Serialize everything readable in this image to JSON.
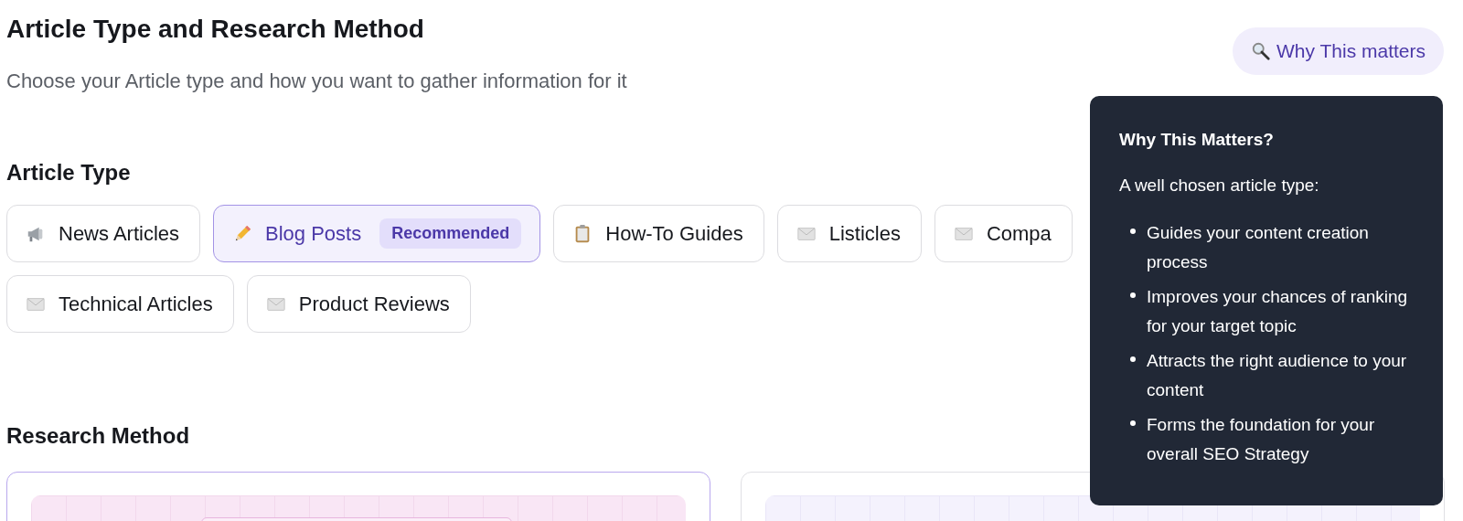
{
  "header": {
    "title": "Article Type and Research Method",
    "subtitle": "Choose your Article type and how you want to gather information for it",
    "help_button": {
      "label": "Why This matters"
    }
  },
  "article_type": {
    "heading": "Article Type",
    "options": [
      {
        "label": "News Articles",
        "kind": "megaphone",
        "selected": false
      },
      {
        "label": "Blog Posts",
        "kind": "pencil",
        "selected": true,
        "badge": "Recommended"
      },
      {
        "label": "How-To Guides",
        "kind": "clipboard",
        "selected": false
      },
      {
        "label": "Listicles",
        "kind": "envelope",
        "selected": false
      },
      {
        "label": "Compa",
        "kind": "envelope",
        "selected": false
      },
      {
        "label": "Technical Articles",
        "kind": "envelope",
        "selected": false
      },
      {
        "label": "Product Reviews",
        "kind": "envelope",
        "selected": false
      }
    ]
  },
  "research_method": {
    "heading": "Research Method",
    "options": [
      {
        "selected": true
      },
      {
        "selected": false
      }
    ]
  },
  "tooltip": {
    "title": "Why This Matters?",
    "intro": "A well chosen article type:",
    "points": [
      "Guides your content creation process",
      "Improves your chances of ranking for your target topic",
      "Attracts the right audience to your content",
      "Forms the foundation for your overall SEO Strategy"
    ]
  }
}
